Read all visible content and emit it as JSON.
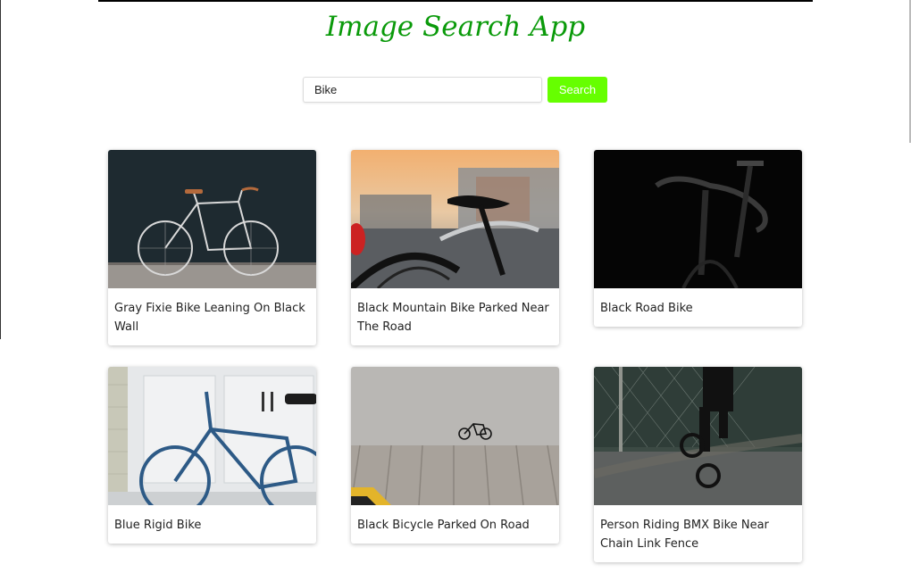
{
  "app": {
    "title": "Image Search App"
  },
  "search": {
    "value": "Bike",
    "button_label": "Search"
  },
  "results": [
    {
      "caption": "Gray Fixie Bike Leaning On Black Wall"
    },
    {
      "caption": "Black Mountain Bike Parked Near The Road"
    },
    {
      "caption": "Black Road Bike"
    },
    {
      "caption": "Blue Rigid Bike"
    },
    {
      "caption": "Black Bicycle Parked On Road"
    },
    {
      "caption": "Person Riding BMX Bike Near Chain Link Fence"
    }
  ],
  "colors": {
    "accent": "#66ff00",
    "title": "#0a9a0a"
  }
}
